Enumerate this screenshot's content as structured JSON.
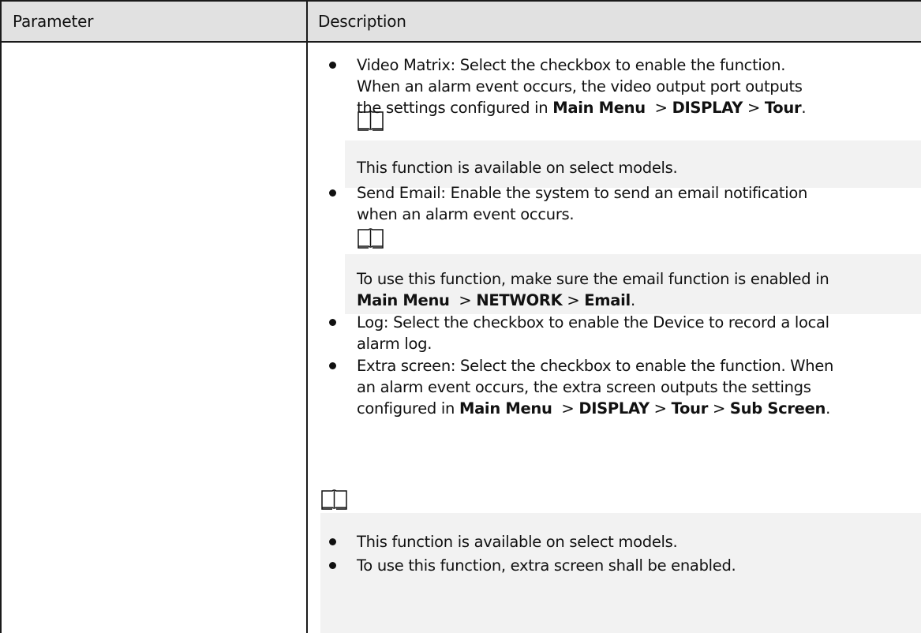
{
  "table": {
    "headers": {
      "parameter": "Parameter",
      "description": "Description"
    },
    "parameter_value": ""
  },
  "description": {
    "video_matrix": {
      "lines": [
        "Video Matrix: Select the checkbox to enable the function.",
        "When an alarm event occurs, the video output port outputs",
        "the settings configured in "
      ],
      "path": [
        "Main Menu",
        "DISPLAY",
        "Tour"
      ],
      "note": "This function is available on select models."
    },
    "send_email": {
      "lines": [
        "Send Email: Enable the system to send an email notification",
        "when an alarm event occurs."
      ],
      "note_line1": "To use this function, make sure the email function is enabled in",
      "note_path": [
        "Main Menu",
        "NETWORK",
        "Email"
      ]
    },
    "log": {
      "lines": [
        "Log: Select the checkbox to enable the Device to record a local",
        "alarm log."
      ]
    },
    "extra_screen": {
      "lines": [
        "Extra screen: Select the checkbox to enable the function. When",
        "an alarm event occurs, the extra screen outputs the settings",
        "configured in "
      ],
      "path": [
        "Main Menu",
        "DISPLAY",
        "Tour",
        "Sub Screen"
      ]
    },
    "final_notes": [
      "This function is available on select models.",
      "To use this function, extra screen shall be enabled."
    ]
  },
  "icons": {
    "note": "note-book-icon",
    "bullet": "bullet-dot-icon"
  },
  "colors": {
    "header_bg": "#e1e1e1",
    "note_bg": "#f2f2f2",
    "border": "#1a1a1a",
    "text": "#111111"
  }
}
